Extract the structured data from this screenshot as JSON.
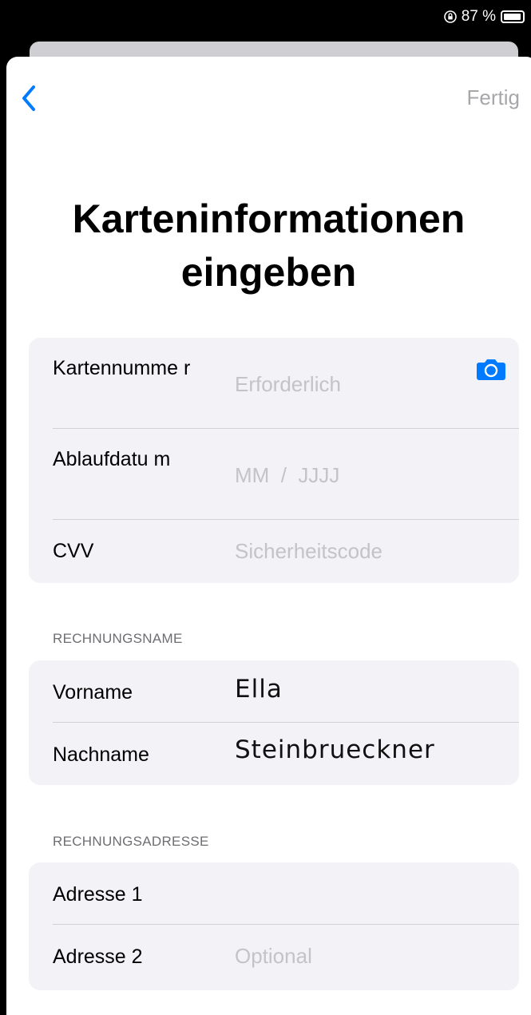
{
  "status_bar": {
    "battery": "87 %",
    "lock_icon": "orientation-lock-icon",
    "battery_icon": "battery-icon"
  },
  "nav": {
    "back_icon": "chevron-left-icon",
    "done_label": "Fertig"
  },
  "title": "Karteninformationen eingeben",
  "card_section": {
    "rows": [
      {
        "label": "Kartennumme r",
        "placeholder": "Erforderlich",
        "icon": "camera-icon"
      },
      {
        "label": "Ablaufdatu m",
        "placeholder": "MM  /  JJJJ"
      },
      {
        "label": "CVV",
        "placeholder": "Sicherheitscode"
      }
    ]
  },
  "billing_name": {
    "header": "RECHNUNGSNAME",
    "rows": [
      {
        "label": "Vorname",
        "value": "Ella"
      },
      {
        "label": "Nachname",
        "value": "Steinbrueckner"
      }
    ]
  },
  "billing_address": {
    "header": "RECHNUNGSADRESSE",
    "rows": [
      {
        "label": "Adresse 1",
        "value": ""
      },
      {
        "label": "Adresse 2",
        "placeholder": "Optional"
      }
    ]
  },
  "colors": {
    "accent": "#007aff",
    "group_bg": "#f2f2f7",
    "placeholder": "#c4c4c6"
  }
}
